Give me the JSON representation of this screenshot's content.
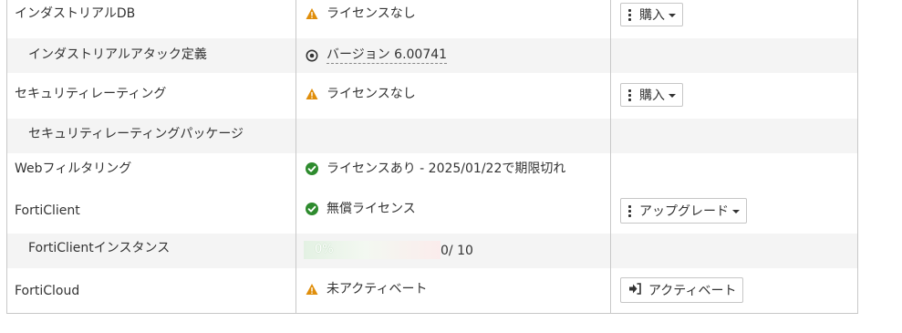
{
  "rows": [
    {
      "name": "インダストリアルDB",
      "status": "ライセンスなし",
      "status_icon": "warning-icon",
      "action": "購入"
    },
    {
      "name": "インダストリアルアタック定義",
      "status": "バージョン 6.00741",
      "status_icon": "version-circle-icon"
    },
    {
      "name": "セキュリティレーティング",
      "status": "ライセンスなし",
      "status_icon": "warning-icon",
      "action": "購入"
    },
    {
      "name": "セキュリティレーティングパッケージ"
    },
    {
      "name": "Webフィルタリング",
      "status": "ライセンスあり - 2025/01/22で期限切れ",
      "status_icon": "check-circle-icon"
    },
    {
      "name": "FortiClient",
      "status": "無償ライセンス",
      "status_icon": "check-circle-icon",
      "action": "アップグレード"
    },
    {
      "name": "FortiClientインスタンス",
      "progress": {
        "percent_label": "0%",
        "quota": "0/ 10",
        "fraction": 0
      }
    },
    {
      "name": "FortiCloud",
      "status": "未アクティベート",
      "status_icon": "warning-icon",
      "action": "アクティベート"
    }
  ],
  "colors": {
    "warning": "#e08e0b",
    "ok": "#2e8b2e",
    "border": "#c8c8c8",
    "alt_row": "#f4f4f4"
  }
}
